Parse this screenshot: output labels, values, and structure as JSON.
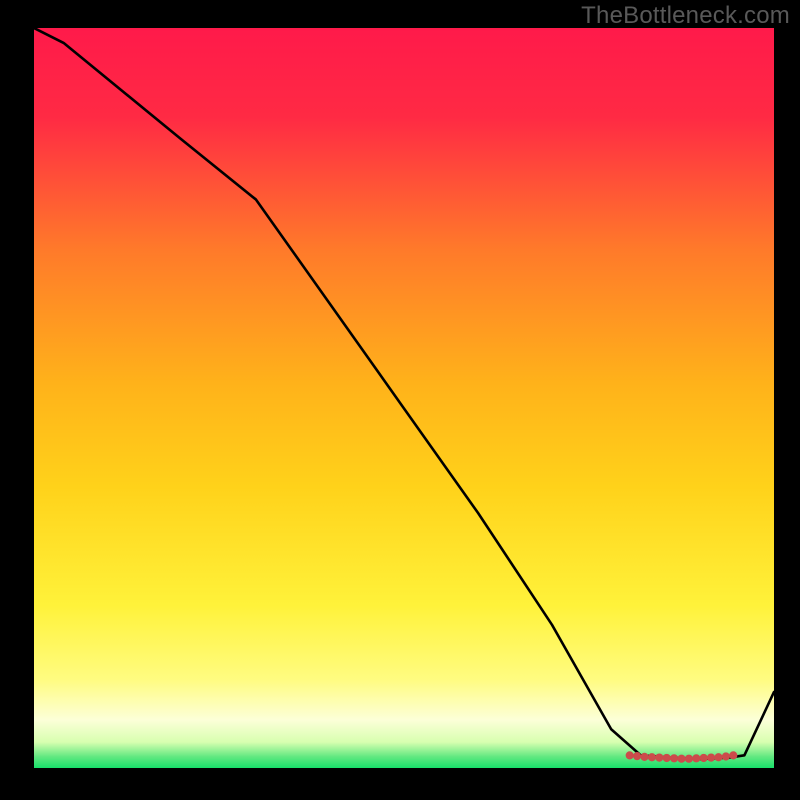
{
  "watermark": "TheBottleneck.com",
  "colors": {
    "top": "#ff1a4a",
    "mid_upper": "#ff7a2a",
    "mid": "#ffd21a",
    "mid_lower": "#fffc66",
    "pale": "#fcffd0",
    "green": "#18e06a",
    "line": "#000000",
    "dots": "#cc4b4b"
  },
  "chart_data": {
    "type": "line",
    "title": "",
    "xlabel": "",
    "ylabel": "",
    "xlim": [
      0,
      100
    ],
    "ylim": [
      0,
      100
    ],
    "series": [
      {
        "name": "curve",
        "x": [
          0,
          4,
          20,
          30,
          40,
          50,
          60,
          70,
          78,
          82,
          86,
          90,
          94,
          96,
          100
        ],
        "y": [
          100,
          98,
          85,
          77,
          63,
          49,
          35,
          20,
          6,
          2.5,
          2.2,
          2.0,
          2.2,
          2.5,
          11
        ]
      }
    ],
    "dots": {
      "x": [
        80.5,
        81.5,
        82.5,
        83.5,
        84.5,
        85.5,
        86.5,
        87.5,
        88.5,
        89.5,
        90.5,
        91.5,
        92.5,
        93.5,
        94.5
      ],
      "y": [
        2.5,
        2.4,
        2.3,
        2.25,
        2.2,
        2.15,
        2.1,
        2.05,
        2.05,
        2.1,
        2.15,
        2.2,
        2.25,
        2.35,
        2.5
      ]
    },
    "gradient_stops": [
      {
        "offset": 0.0,
        "color": "#ff1a4a"
      },
      {
        "offset": 0.12,
        "color": "#ff2a44"
      },
      {
        "offset": 0.3,
        "color": "#ff7a2a"
      },
      {
        "offset": 0.48,
        "color": "#ffb21a"
      },
      {
        "offset": 0.62,
        "color": "#ffd21a"
      },
      {
        "offset": 0.78,
        "color": "#fff23a"
      },
      {
        "offset": 0.88,
        "color": "#fffc80"
      },
      {
        "offset": 0.935,
        "color": "#fcffd8"
      },
      {
        "offset": 0.965,
        "color": "#d8ffb0"
      },
      {
        "offset": 0.985,
        "color": "#60e880"
      },
      {
        "offset": 1.0,
        "color": "#18e06a"
      }
    ]
  }
}
